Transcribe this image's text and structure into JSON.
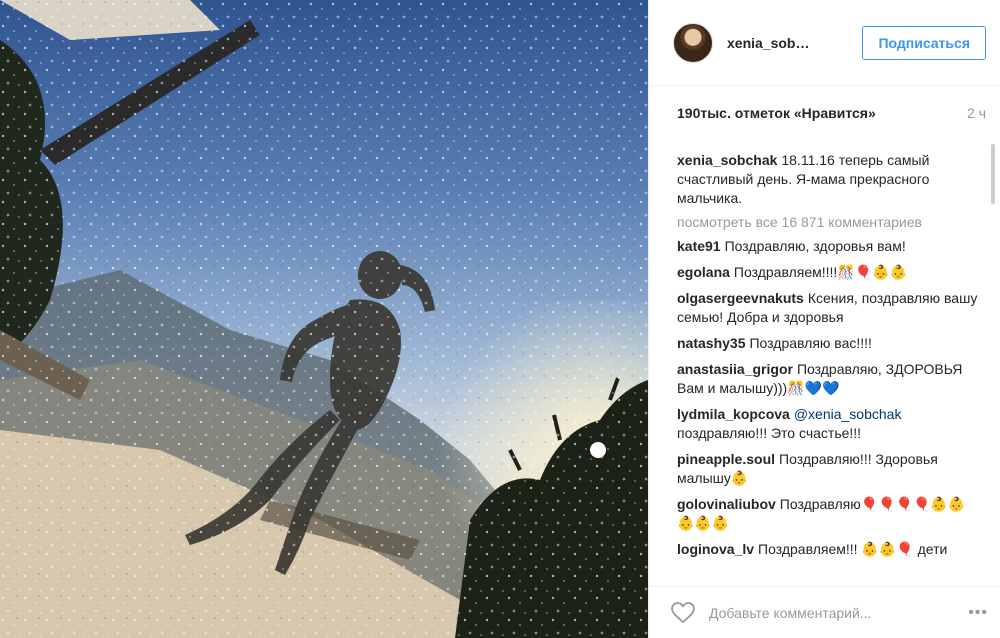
{
  "post": {
    "photo_alt": "",
    "username": "xenia_sob…",
    "follow_label": "Подписаться",
    "likes": "190тыс. отметок «Нравится»",
    "time": "2 ч",
    "caption_user": "xenia_sobchak",
    "caption_text": "18.11.16 теперь самый счастливый день. Я-мама прекрасного мальчика.",
    "view_all": "посмотреть все 16 871 комментариев",
    "comments": [
      {
        "user": "kate91",
        "text": "Поздравляю, здоровья вам!"
      },
      {
        "user": "egolana",
        "text": "Поздравляем!!!!🎊🎈👶👶"
      },
      {
        "user": "olgasergeevnakuts",
        "text": "Ксения, поздравляю вашу семью! Добра и здоровья"
      },
      {
        "user": "natashy35",
        "text": "Поздравляю вас!!!!"
      },
      {
        "user": "anastasiia_grigor",
        "text": "Поздравляю, ЗДОРОВЬЯ Вам и малышу)))🎊💙💙"
      },
      {
        "user": "lydmila_kopcova",
        "mention": "@xenia_sobchak",
        "text": "поздравляю!!! Это счастье!!!"
      },
      {
        "user": "pineapple.soul",
        "text": "Поздравляю!!! Здоровья малышу👶"
      },
      {
        "user": "golovinaliubov",
        "text": "Поздравляю🎈🎈🎈🎈👶👶👶👶👶"
      },
      {
        "user": "loginova_lv",
        "text": "Поздравляем!!! 👶👶🎈 дети"
      }
    ],
    "comment_placeholder": "Добавьте комментарий...",
    "more_icon": "more-dots-icon",
    "like_icon": "heart-icon"
  },
  "colors": {
    "accent": "#3897f0",
    "text": "#262626",
    "muted": "#999999"
  }
}
